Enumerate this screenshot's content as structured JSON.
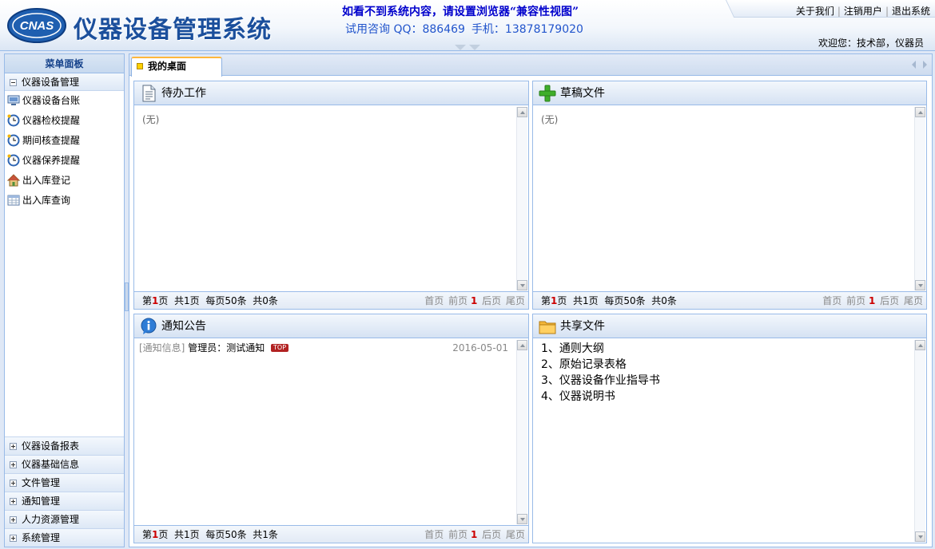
{
  "header": {
    "logo_text": "CNAS",
    "app_title": "仪器设备管理系统",
    "notice": "如看不到系统内容，请设置浏览器“兼容性视图”",
    "contact_qq": "试用咨询 QQ：886469",
    "contact_phone": "手机：13878179020",
    "links": [
      "关于我们",
      "注销用户",
      "退出系统"
    ],
    "welcome": "欢迎您：技术部，仪器员"
  },
  "sidebar": {
    "title": "菜单面板",
    "open_group": "仪器设备管理",
    "items": [
      {
        "label": "仪器设备台账",
        "icon": "monitor-icon"
      },
      {
        "label": "仪器检校提醒",
        "icon": "clock-icon"
      },
      {
        "label": "期间核查提醒",
        "icon": "clock-icon"
      },
      {
        "label": "仪器保养提醒",
        "icon": "clock-icon"
      },
      {
        "label": "出入库登记",
        "icon": "house-icon"
      },
      {
        "label": "出入库查询",
        "icon": "table-icon"
      }
    ],
    "collapsed_groups": [
      "仪器设备报表",
      "仪器基础信息",
      "文件管理",
      "通知管理",
      "人力资源管理",
      "系统管理"
    ]
  },
  "tabs": [
    {
      "label": "我的桌面"
    }
  ],
  "panels": {
    "todo": {
      "title": "待办工作",
      "icon": "document-icon",
      "empty": "(无)",
      "pager": {
        "prefix": "第",
        "page": "1",
        "suffix": "页",
        "total_pages": "共1页",
        "per_page": "每页50条",
        "total": "共0条"
      }
    },
    "drafts": {
      "title": "草稿文件",
      "icon": "plus-icon",
      "empty": "(无)",
      "pager": {
        "prefix": "第",
        "page": "1",
        "suffix": "页",
        "total_pages": "共1页",
        "per_page": "每页50条",
        "total": "共0条"
      }
    },
    "notices": {
      "title": "通知公告",
      "icon": "info-icon",
      "items": [
        {
          "category": "[通知信息]",
          "text": "管理员：测试通知",
          "badge": "TOP",
          "date": "2016-05-01"
        }
      ],
      "pager": {
        "prefix": "第",
        "page": "1",
        "suffix": "页",
        "total_pages": "共1页",
        "per_page": "每页50条",
        "total": "共1条"
      }
    },
    "shared": {
      "title": "共享文件",
      "icon": "folder-icon",
      "files": [
        "1、通则大纲",
        "2、原始记录表格",
        "3、仪器设备作业指导书",
        "4、仪器说明书"
      ]
    }
  },
  "pager_nav": {
    "first": "首页",
    "prev": "前页",
    "current": "1",
    "next": "后页",
    "last": "尾页"
  },
  "colors": {
    "brand_blue": "#1b4f9c",
    "border": "#99bbe8",
    "accent_red": "#cc0000",
    "tab_accent": "#ffb73d"
  }
}
